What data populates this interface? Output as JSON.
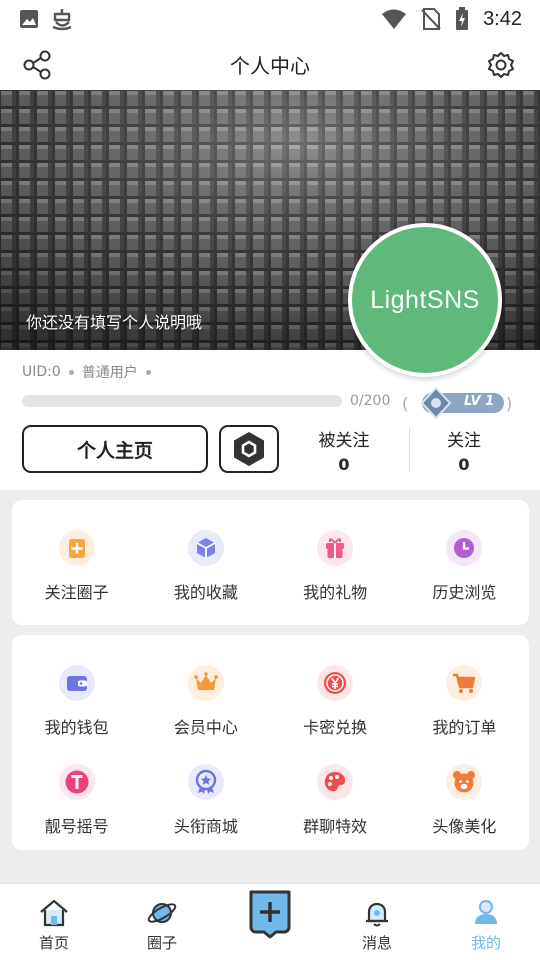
{
  "status_bar": {
    "time": "3:42"
  },
  "header": {
    "title": "个人中心"
  },
  "banner": {
    "bio": "你还没有填写个人说明哦"
  },
  "avatar": {
    "text": "LightSNS"
  },
  "profile": {
    "uid": "UID:0",
    "role": "普通用户",
    "xp_text": "0/200",
    "xp_progress": 0,
    "level": "LV 1",
    "home_button": "个人主页",
    "followers_label": "被关注",
    "followers_count": "0",
    "following_label": "关注",
    "following_count": "0"
  },
  "quick_menu": [
    {
      "label": "关注圈子",
      "icon": "plus-square-icon"
    },
    {
      "label": "我的收藏",
      "icon": "cube-icon"
    },
    {
      "label": "我的礼物",
      "icon": "gift-icon"
    },
    {
      "label": "历史浏览",
      "icon": "clock-icon"
    }
  ],
  "services_menu": [
    {
      "label": "我的钱包",
      "icon": "wallet-icon"
    },
    {
      "label": "会员中心",
      "icon": "crown-icon"
    },
    {
      "label": "卡密兑换",
      "icon": "yen-coin-icon"
    },
    {
      "label": "我的订单",
      "icon": "cart-icon"
    },
    {
      "label": "靓号摇号",
      "icon": "t-badge-icon"
    },
    {
      "label": "头衔商城",
      "icon": "medal-icon"
    },
    {
      "label": "群聊特效",
      "icon": "palette-icon"
    },
    {
      "label": "头像美化",
      "icon": "bear-icon"
    }
  ],
  "bottom_nav": [
    {
      "label": "首页",
      "icon": "home-icon"
    },
    {
      "label": "圈子",
      "icon": "planet-icon"
    },
    {
      "label": "",
      "icon": "publish-plus-icon"
    },
    {
      "label": "消息",
      "icon": "bell-icon"
    },
    {
      "label": "我的",
      "icon": "user-icon",
      "active": true
    }
  ],
  "colors": {
    "accent_green": "#5eb97a",
    "active_nav": "#72b8e8"
  }
}
